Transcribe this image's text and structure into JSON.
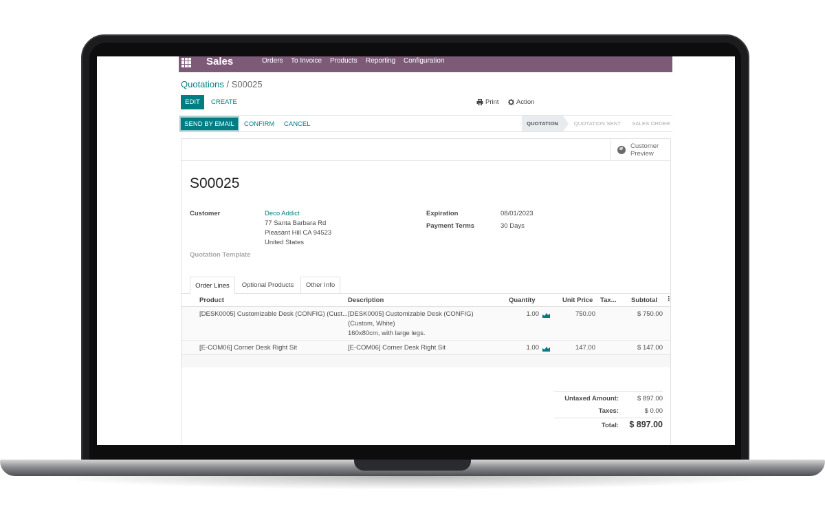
{
  "navbar": {
    "app_name": "Sales",
    "menu": [
      "Orders",
      "To Invoice",
      "Products",
      "Reporting",
      "Configuration"
    ],
    "color": "#7c5a78"
  },
  "breadcrumb": {
    "parent": "Quotations",
    "separator": "/",
    "current": "S00025"
  },
  "control_panel": {
    "edit_label": "EDIT",
    "create_label": "CREATE",
    "print_label": "Print",
    "action_label": "Action"
  },
  "statusbar": {
    "send_email_label": "SEND BY EMAIL",
    "confirm_label": "CONFIRM",
    "cancel_label": "CANCEL",
    "stages": [
      "QUOTATION",
      "QUOTATION SENT",
      "SALES ORDER"
    ],
    "active_stage": "QUOTATION"
  },
  "sheet": {
    "preview_label": "Customer Preview",
    "record_name": "S00025",
    "customer_label": "Customer",
    "customer_name": "Deco Addict",
    "address": [
      "77 Santa Barbara Rd",
      "Pleasant Hill CA 94523",
      "United States"
    ],
    "expiration_label": "Expiration",
    "expiration_value": "08/01/2023",
    "payment_terms_label": "Payment Terms",
    "payment_terms_value": "30 Days",
    "template_label": "Quotation Template"
  },
  "tabs": [
    "Order Lines",
    "Optional Products",
    "Other Info"
  ],
  "order_lines": {
    "columns": [
      "Product",
      "Description",
      "Quantity",
      "Unit Price",
      "Tax...",
      "Subtotal"
    ],
    "rows": [
      {
        "product": "[DESK0005] Customizable Desk (CONFIG) (Cust...",
        "description": [
          "[DESK0005] Customizable Desk (CONFIG)",
          "(Custom, White)",
          "160x80cm, with large legs."
        ],
        "quantity": "1.00",
        "unit_price": "750.00",
        "subtotal": "$ 750.00"
      },
      {
        "product": "[E-COM06] Corner Desk Right Sit",
        "description": [
          "[E-COM06] Corner Desk Right Sit"
        ],
        "quantity": "1.00",
        "unit_price": "147.00",
        "subtotal": "$ 147.00"
      }
    ]
  },
  "totals": {
    "untaxed_label": "Untaxed Amount:",
    "untaxed_value": "$ 897.00",
    "taxes_label": "Taxes:",
    "taxes_value": "$ 0.00",
    "total_label": "Total:",
    "total_value": "$ 897.00"
  },
  "accent_color": "#017e84"
}
